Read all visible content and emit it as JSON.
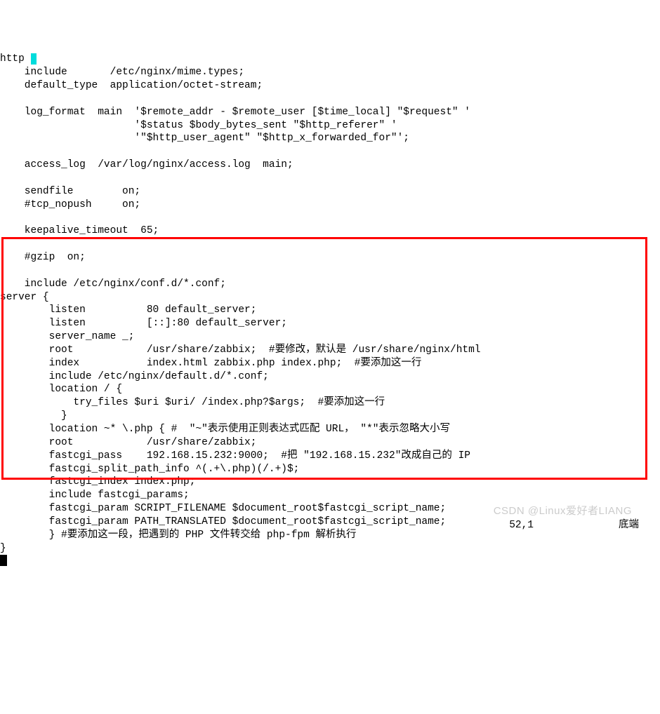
{
  "code": {
    "l01": "http ",
    "l01_cursor": "{",
    "l02": "    include       /etc/nginx/mime.types;",
    "l03": "    default_type  application/octet-stream;",
    "l04": "",
    "l05": "    log_format  main  '$remote_addr - $remote_user [$time_local] \"$request\" '",
    "l06": "                      '$status $body_bytes_sent \"$http_referer\" '",
    "l07": "                      '\"$http_user_agent\" \"$http_x_forwarded_for\"';",
    "l08": "",
    "l09": "    access_log  /var/log/nginx/access.log  main;",
    "l10": "",
    "l11": "    sendfile        on;",
    "l12": "    #tcp_nopush     on;",
    "l13": "",
    "l14": "    keepalive_timeout  65;",
    "l15": "",
    "l16": "    #gzip  on;",
    "l17": "",
    "l18": "    include /etc/nginx/conf.d/*.conf;",
    "l19": "server {",
    "l20": "        listen          80 default_server;",
    "l21": "        listen          [::]:80 default_server;",
    "l22": "        server_name _;",
    "l23": "        root            /usr/share/zabbix;  #要修改，默认是 /usr/share/nginx/html",
    "l24": "        index           index.html zabbix.php index.php;  #要添加这一行",
    "l25": "        include /etc/nginx/default.d/*.conf;",
    "l26": "        location / {",
    "l27": "            try_files $uri $uri/ /index.php?$args;  #要添加这一行",
    "l28": "          }",
    "l29": "        location ~* \\.php { #  \"~\"表示使用正则表达式匹配 URL， \"*\"表示忽略大小写",
    "l30": "        root            /usr/share/zabbix;",
    "l31": "        fastcgi_pass    192.168.15.232:9000;  #把 \"192.168.15.232\"改成自己的 IP",
    "l32": "        fastcgi_split_path_info ^(.+\\.php)(/.+)$;",
    "l33": "        fastcgi_index index.php;",
    "l34": "        include fastcgi_params;",
    "l35": "        fastcgi_param SCRIPT_FILENAME $document_root$fastcgi_script_name;",
    "l36": "        fastcgi_param PATH_TRANSLATED $document_root$fastcgi_script_name;",
    "l37": "        } #要添加这一段，把遇到的 PHP 文件转交给 php-fpm 解析执行",
    "l38": "}"
  },
  "status": {
    "position": "52,1",
    "location": "底端"
  },
  "watermark": "CSDN @Linux爱好者LIANG"
}
